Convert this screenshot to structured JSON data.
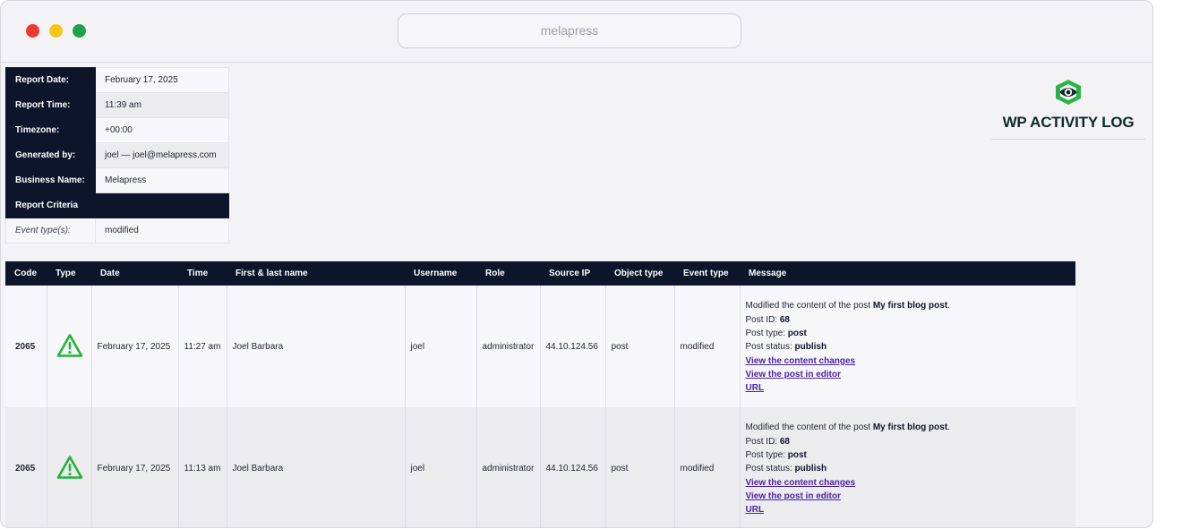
{
  "browser": {
    "address": "melapress",
    "colors": {
      "close": "#ec3b2f",
      "minimize": "#f5c518",
      "maximize": "#1fa34a"
    }
  },
  "logo": {
    "text": "WP ACTIVITY LOG",
    "icon": "eye-icon",
    "color": "#2bb34a"
  },
  "report_info": {
    "rows": [
      {
        "label": "Report Date:",
        "value": "February 17, 2025"
      },
      {
        "label": "Report Time:",
        "value": "11:39 am"
      },
      {
        "label": "Timezone:",
        "value": "+00:00"
      },
      {
        "label": "Generated by:",
        "value": "joel — joel@melapress.com"
      },
      {
        "label": "Business Name:",
        "value": "Melapress"
      }
    ],
    "criteria_heading": "Report Criteria",
    "criteria": {
      "label": "Event type(s):",
      "value": "modified"
    }
  },
  "events": {
    "headers": [
      "Code",
      "Type",
      "Date",
      "Time",
      "First & last name",
      "Username",
      "Role",
      "Source IP",
      "Object type",
      "Event type",
      "Message"
    ],
    "type_icon": "warning-icon",
    "type_color": "#22b33a",
    "rows": [
      {
        "code": "2065",
        "date": "February 17, 2025",
        "time": "11:27 am",
        "name": "Joel Barbara",
        "username": "joel",
        "role": "administrator",
        "ip": "44.10.124.56",
        "object_type": "post",
        "event_type": "modified",
        "message": {
          "intro": "Modified the content of the post ",
          "post_title": "My first blog post",
          "intro_end": ".",
          "post_id_label": "Post ID: ",
          "post_id": "68",
          "post_type_label": "Post type: ",
          "post_type": "post",
          "post_status_label": "Post status: ",
          "post_status": "publish",
          "link_changes": "View the content changes",
          "link_editor": "View the post in editor",
          "link_url": "URL"
        }
      },
      {
        "code": "2065",
        "date": "February 17, 2025",
        "time": "11:13 am",
        "name": "Joel Barbara",
        "username": "joel",
        "role": "administrator",
        "ip": "44.10.124.56",
        "object_type": "post",
        "event_type": "modified",
        "message": {
          "intro": "Modified the content of the post ",
          "post_title": "My first blog post",
          "intro_end": ".",
          "post_id_label": "Post ID: ",
          "post_id": "68",
          "post_type_label": "Post type: ",
          "post_type": "post",
          "post_status_label": "Post status: ",
          "post_status": "publish",
          "link_changes": "View the content changes",
          "link_editor": "View the post in editor",
          "link_url": "URL"
        }
      }
    ]
  }
}
